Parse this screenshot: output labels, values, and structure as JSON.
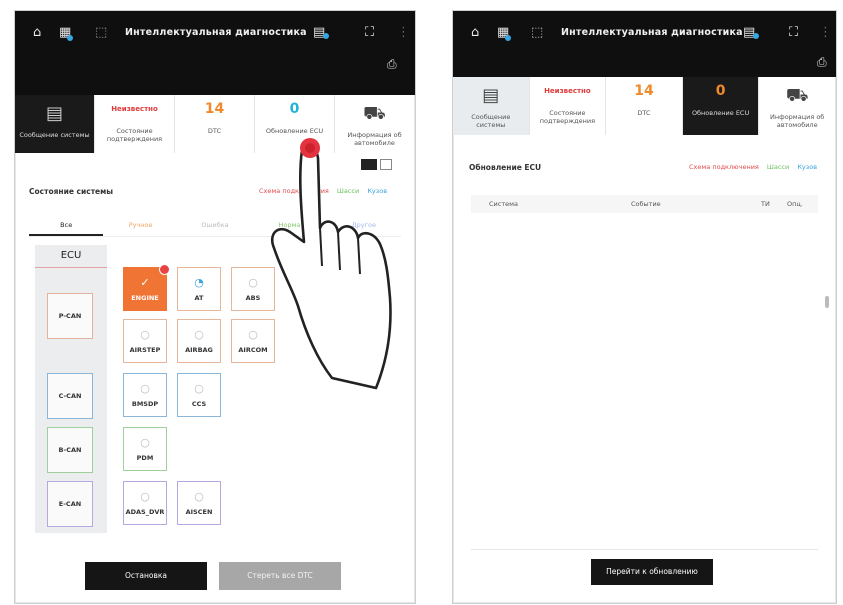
{
  "left": {
    "title": "Интеллектуальная диагностика",
    "tiles": [
      {
        "label": "Сообщение системы",
        "value": ""
      },
      {
        "value": "Неизвестно",
        "label": "Состояние подтверждения"
      },
      {
        "value": "14",
        "label": "DTC"
      },
      {
        "value": "0",
        "label": "Обновление ECU"
      },
      {
        "value": "",
        "label": "Информация об автомобиле"
      }
    ],
    "section_title": "Состояние системы",
    "links": {
      "a": "Схема подключения",
      "b": "Шасси",
      "c": "Кузов"
    },
    "filters": [
      "Все",
      "Ручное",
      "Ошибка",
      "Норма",
      "Другое"
    ],
    "ecu_header": "ECU",
    "buses": [
      "P-CAN",
      "C-CAN",
      "B-CAN",
      "E-CAN"
    ],
    "modules": {
      "engine": "ENGINE",
      "at": "AT",
      "abs": "ABS",
      "airstep": "AIRSTEP",
      "airbag": "AIRBAG",
      "aircom": "AIRCOM",
      "bmsdp": "BMSDP",
      "ccs": "CCS",
      "pdm": "PDM",
      "adas_dvr": "ADAS_DVR",
      "aiscen": "AISCEN"
    },
    "buttons": {
      "stop": "Остановка",
      "clear": "Стереть все DTC"
    }
  },
  "right": {
    "title": "Интеллектуальная диагностика",
    "tiles": [
      {
        "label": "Сообщение системы",
        "value": ""
      },
      {
        "value": "Неизвестно",
        "label": "Состояние подтверждения"
      },
      {
        "value": "14",
        "label": "DTC"
      },
      {
        "value": "0",
        "label": "Обновление ECU"
      },
      {
        "value": "",
        "label": "Информация об автомобиле"
      }
    ],
    "section_title": "Обновление ECU",
    "links": {
      "a": "Схема подключения",
      "b": "Шасси",
      "c": "Кузов"
    },
    "table_headers": [
      "Система",
      "Событие",
      "ТИ",
      "Опц."
    ],
    "button": "Перейти к обновлению"
  }
}
